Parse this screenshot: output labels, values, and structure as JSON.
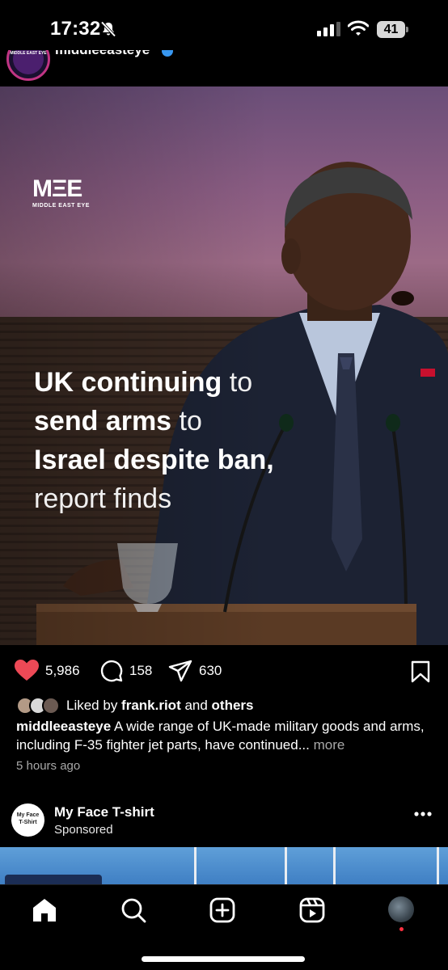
{
  "status_bar": {
    "time": "17:32",
    "battery": "41",
    "icons": [
      "bell-slash-icon",
      "cellular-signal-icon",
      "wifi-icon",
      "battery-icon"
    ]
  },
  "post": {
    "username": "middleeasteye",
    "verified": true,
    "image": {
      "logo_mark": "MΞE",
      "logo_sub": "MIDDLE EAST EYE",
      "headline_lines": [
        {
          "bold": "UK continuing",
          "light": " to"
        },
        {
          "bold": "send arms",
          "light": " to"
        },
        {
          "bold": "Israel despite ban,",
          "light": ""
        },
        {
          "bold": "",
          "light": "report finds"
        }
      ]
    },
    "likes": "5,986",
    "comments": "158",
    "shares": "630",
    "liked_by_prefix": "Liked by ",
    "liked_by_user": "frank.riot",
    "liked_by_and": " and ",
    "liked_by_others": "others",
    "caption_user": "middleeasteye",
    "caption_text": " A wide range of UK-made military goods and arms, including F-35 fighter jet parts, have continued...",
    "caption_more": " more",
    "time_ago": "5 hours ago"
  },
  "sponsored": {
    "avatar_line1": "My Face",
    "avatar_line2": "T-Shirt",
    "name": "My Face T-shirt",
    "label": "Sponsored"
  },
  "nav": {
    "items": [
      "home-icon",
      "search-icon",
      "create-icon",
      "reels-icon",
      "profile-avatar"
    ]
  },
  "colors": {
    "like": "#ed4956",
    "verified": "#3897f0",
    "background": "#000000",
    "secondary_text": "#a8a8a8"
  }
}
